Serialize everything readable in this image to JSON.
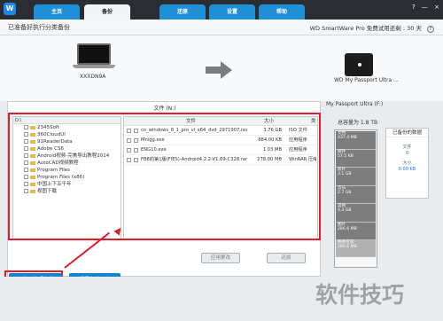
{
  "header": {
    "logo": "W",
    "tabs": [
      "主页",
      "备份",
      "还原",
      "设置",
      "帮助"
    ],
    "window_controls": [
      "?",
      "—",
      "×"
    ]
  },
  "status": {
    "left": "已准备好执行分类备份",
    "product": "WD SmartWare Pro 免费试用还剩 : 30 天",
    "help": "?"
  },
  "hero": {
    "computer_name": "XXXDN9A",
    "drive_name": "WD My Passport Ultra ..."
  },
  "file_panel": {
    "title": "文件 (N:)",
    "tree_root": "D:\\",
    "tree_items": [
      "2345Soft",
      "360CloudUI",
      "91ReaderData",
      "Adobe CS6",
      "Android视频-完美导出教程2014",
      "AutoCAD视频教程",
      "Program Files",
      "Program Files (x86)",
      "中国上下五千年",
      "视图下载"
    ],
    "file_headers": {
      "name": "文件",
      "size": "大小",
      "type": "类"
    },
    "files": [
      {
        "name": "cn_windows_8_1_pro_vl_x64_dvd_2971907.iso",
        "size": "3.76 GB",
        "type": "ISO 文件"
      },
      {
        "name": "Mnigg.exe",
        "size": "884.00 KB",
        "type": "应用程序"
      },
      {
        "name": "ENG10.exe",
        "size": "1.03 MB",
        "type": "应用程序"
      },
      {
        "name": "FB8的第1版(FIES)-Android4.2.2-V1.09-C328.rar",
        "size": "278.00 MB",
        "type": "WinRAR 压缩"
      }
    ],
    "buttons": {
      "apply": "应用更改",
      "restore": "还原"
    }
  },
  "drive": {
    "title": "My Passport Ultra (F:)",
    "capacity_label": "总容量为 1.8 TB",
    "segments": [
      {
        "label": "文档",
        "value": "437.4 MB"
      },
      {
        "label": "邮件",
        "value": "57.5 KB"
      },
      {
        "label": "影片",
        "value": "3.1 GB"
      },
      {
        "label": "音乐",
        "value": "2.7 GB"
      },
      {
        "label": "其他",
        "value": "4.3 GB"
      },
      {
        "label": "图片",
        "value": "286.6 MB"
      },
      {
        "label": "剩余空间",
        "value": "286.6 MB"
      }
    ],
    "backup_box": {
      "title": "已备份的数据",
      "count_label": "文件",
      "count_value": "0",
      "size_label": "大小",
      "size_value": "0.00 KB"
    }
  },
  "actions": {
    "switch": "切换到按照备份",
    "settings": "设置备份频率"
  },
  "watermark": "软件技巧",
  "colors": {
    "accent_blue": "#1383cf",
    "highlight_red": "#e11d2b"
  }
}
